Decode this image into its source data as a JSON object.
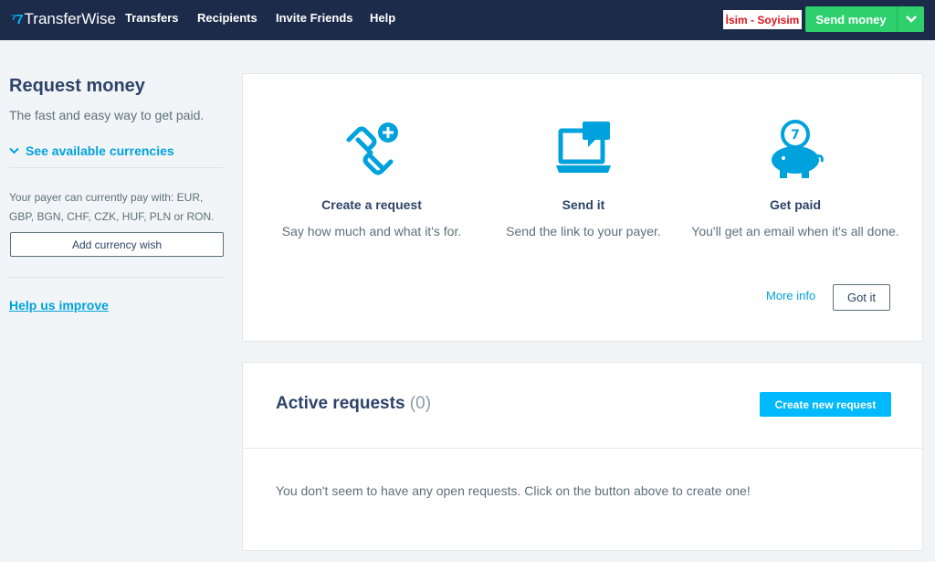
{
  "header": {
    "logo_mark": "⁷7",
    "logo_text": "TransferWise",
    "nav": [
      "Transfers",
      "Recipients",
      "Invite Friends",
      "Help"
    ],
    "user_name": "İsim - Soyisim",
    "send_money_label": "Send money"
  },
  "sidebar": {
    "title": "Request money",
    "subtitle": "The fast and easy way to get paid.",
    "currencies_link": "See available currencies",
    "payer_text": "Your payer can currently pay with: EUR, GBP, BGN, CHF, CZK, HUF, PLN or RON.",
    "add_currency_label": "Add currency wish",
    "help_link": "Help us improve"
  },
  "how_it_works": {
    "steps": [
      {
        "title": "Create a request",
        "text": "Say how much and what it's for.",
        "icon": "link-add-icon"
      },
      {
        "title": "Send it",
        "text": "Send the link to your payer.",
        "icon": "laptop-chat-icon"
      },
      {
        "title": "Get paid",
        "text": "You'll get an email when it's all done.",
        "icon": "piggy-bank-icon"
      }
    ],
    "more_info_label": "More info",
    "got_it_label": "Got it"
  },
  "active_requests": {
    "title": "Active requests",
    "count": "(0)",
    "create_label": "Create new request",
    "empty_message": "You don't seem to have any open requests. Click on the button above to create one!"
  },
  "colors": {
    "nav_bg": "#1d2b4a",
    "accent": "#00b9ff",
    "green": "#2ed06e",
    "text": "#2e4369"
  }
}
